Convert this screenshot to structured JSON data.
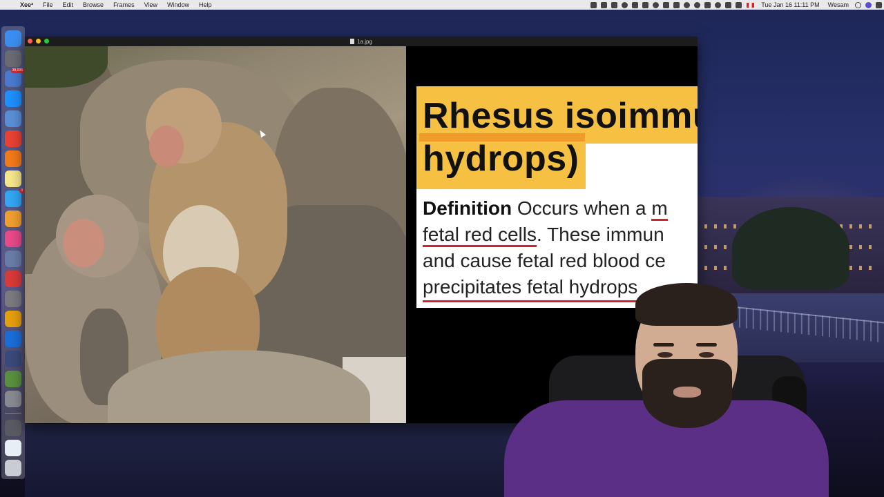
{
  "menubar": {
    "apple": "",
    "app_name": "Xee³",
    "menus": [
      "File",
      "Edit",
      "Browse",
      "Frames",
      "View",
      "Window",
      "Help"
    ],
    "clock": "Tue Jan 16  11:11 PM",
    "user": "Wesam"
  },
  "dock": {
    "items": [
      {
        "name": "finder-icon",
        "color": "#3b8ef0"
      },
      {
        "name": "launchpad-icon",
        "color": "#6b6b73"
      },
      {
        "name": "preview-icon",
        "color": "#4a7bd0",
        "badge": "39,036"
      },
      {
        "name": "app-store-icon",
        "color": "#1e90ff"
      },
      {
        "name": "xcode-icon",
        "color": "#5a8fd6"
      },
      {
        "name": "chrome-icon",
        "color": "#e94235"
      },
      {
        "name": "firefox-icon",
        "color": "#f27a1a"
      },
      {
        "name": "notes-icon",
        "color": "#f7e78c"
      },
      {
        "name": "messages-icon",
        "color": "#33a6f5",
        "badge": "3"
      },
      {
        "name": "photos-icon",
        "color": "#f0a030"
      },
      {
        "name": "itunes-icon",
        "color": "#e84a8a"
      },
      {
        "name": "image-capture-icon",
        "color": "#6a7da8"
      },
      {
        "name": "photo-booth-icon",
        "color": "#d93a3a"
      },
      {
        "name": "system-preferences-icon",
        "color": "#7a7a80"
      },
      {
        "name": "plex-icon",
        "color": "#e5a00d"
      },
      {
        "name": "teamviewer-icon",
        "color": "#1a6ed8"
      },
      {
        "name": "screenshot-icon",
        "color": "#3a4a7a"
      },
      {
        "name": "iphoto-icon",
        "color": "#5a9040"
      },
      {
        "name": "dvd-player-icon",
        "color": "#8a8a92"
      }
    ],
    "bottom_items": [
      {
        "name": "downloads-stack-icon",
        "color": "#5a5a62"
      },
      {
        "name": "documents-stack-icon",
        "color": "#e8eef5"
      },
      {
        "name": "trash-icon",
        "color": "#c9ccd2"
      }
    ]
  },
  "window": {
    "title": "1a.jpg"
  },
  "slide": {
    "title_line1": "Rhesus isoimmu",
    "title_line2": "hydrops)",
    "body_bold": "Definition",
    "body_line1_rest": " Occurs when a ",
    "body_line1_ul": "m",
    "body_line2_ul": "fetal red cells",
    "body_line2_rest": ". These immun",
    "body_line3": "and cause fetal red blood ce",
    "body_line4": "precipitates fetal hydrops"
  }
}
